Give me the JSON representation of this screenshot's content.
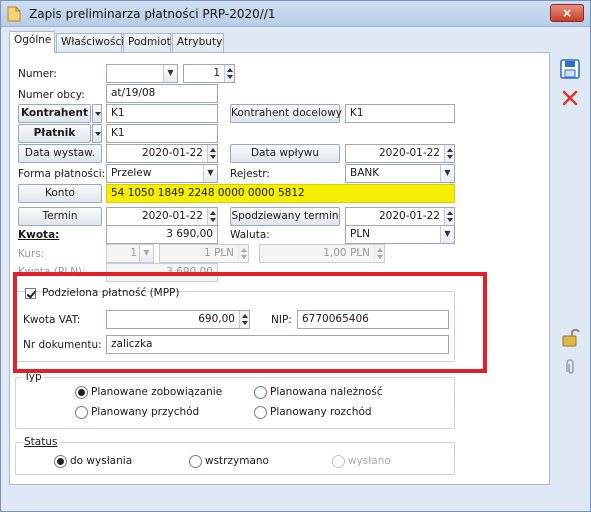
{
  "window": {
    "title": "Zapis preliminarza płatności PRP-2020//1",
    "close_label": "×"
  },
  "tabs": [
    "Ogólne",
    "Właściwości",
    "Podmiot",
    "Atrybuty"
  ],
  "form": {
    "numer_label": "Numer:",
    "numer_value": "1",
    "numer_obcy_label": "Numer obcy:",
    "numer_obcy_value": "at/19/08",
    "kontrahent_btn": "Kontrahent",
    "kontrahent_value": "K1",
    "kontrahent_docelowy_btn": "Kontrahent docelowy",
    "kontrahent_docelowy_value": "K1",
    "platnik_btn": "Płatnik",
    "platnik_value": "K1",
    "data_wystaw_btn": "Data wystaw.",
    "data_wystaw_value": "2020-01-22",
    "data_wplywu_btn": "Data wpływu",
    "data_wplywu_value": "2020-01-22",
    "forma_label": "Forma płatności:",
    "forma_value": "Przelew",
    "rejestr_label": "Rejestr:",
    "rejestr_value": "BANK",
    "konto_btn": "Konto",
    "konto_value": "54 1050 1849 2248 0000 0000 5812",
    "termin_btn": "Termin",
    "termin_value": "2020-01-22",
    "spodziewany_btn": "Spodziewany termin",
    "spodziewany_value": "2020-01-22",
    "kwota_label": "Kwota:",
    "kwota_value": "3 690,00",
    "waluta_label": "Waluta:",
    "waluta_value": "PLN",
    "kurs_label": "Kurs:",
    "kurs_a": "1",
    "kurs_b": "1 PLN",
    "kurs_c": "1,00 PLN",
    "kwota_pln_label": "Kwota (PLN):",
    "kwota_pln_value": "3 690,00"
  },
  "mpp": {
    "checkbox_label": "Podzielona płatność (MPP)",
    "checked": true,
    "kwota_vat_label": "Kwota VAT:",
    "kwota_vat_value": "690,00",
    "nip_label": "NIP:",
    "nip_value": "6770065406",
    "nr_dok_label": "Nr dokumentu:",
    "nr_dok_value": "zaliczka"
  },
  "typ": {
    "title": "Typ",
    "options": [
      "Planowane zobowiązanie",
      "Planowana należność",
      "Planowany przychód",
      "Planowany rozchód"
    ],
    "selected": "Planowane zobowiązanie"
  },
  "status": {
    "title": "Status",
    "options": [
      "do wysłania",
      "wstrzymano",
      "wysłano"
    ],
    "selected": "do wysłania"
  },
  "colors": {
    "highlight": "#e3202a",
    "konto_bg": "#f5ee00",
    "save_icon": "#2e6fc6",
    "delete_icon": "#d63a2a"
  },
  "icons": [
    "save-icon",
    "delete-icon",
    "lock-icon",
    "attach-icon"
  ]
}
